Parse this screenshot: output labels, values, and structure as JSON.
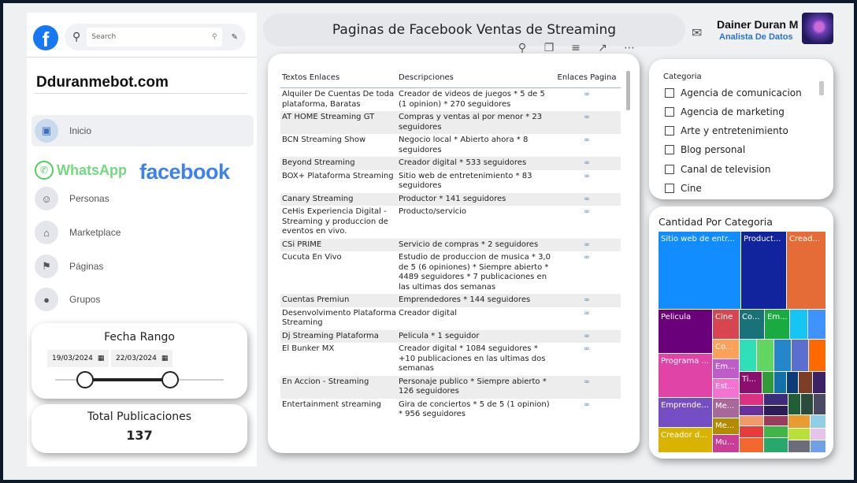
{
  "sidebar": {
    "search_placeholder": "Search",
    "site_title": "Dduranmebot.com",
    "nav": [
      {
        "label": "Inicio",
        "icon": "home-icon"
      },
      {
        "label": "Personas",
        "icon": "people-icon"
      },
      {
        "label": "Marketplace",
        "icon": "store-icon"
      },
      {
        "label": "Páginas",
        "icon": "flag-icon"
      },
      {
        "label": "Grupos",
        "icon": "groups-icon"
      }
    ],
    "whatsapp_label": "WhatsApp",
    "facebook_label": "facebook"
  },
  "date_range": {
    "title": "Fecha Rango",
    "start": "19/03/2024",
    "end": "22/03/2024"
  },
  "kpi": {
    "label": "Total Publicaciones",
    "value": "137"
  },
  "header": {
    "title": "Paginas de Facebook Ventas de Streaming",
    "user_name": "Dainer Duran M",
    "user_role": "Analista De Datos"
  },
  "table": {
    "headers": [
      "Textos Enlaces",
      "Descripciones",
      "Enlaces Pagina"
    ],
    "rows": [
      [
        "Alquiler De Cuentas De toda plataforma, Baratas",
        "Creador de videos de juegos * 5 de 5 (1 opinion) * 270 seguidores"
      ],
      [
        "AT HOME Streaming GT",
        "Compras y ventas al por menor * 23 seguidores"
      ],
      [
        "BCN Streaming Show",
        "Negocio local * Abierto ahora * 8 seguidores"
      ],
      [
        "Beyond Streaming",
        "Creador digital * 533 seguidores"
      ],
      [
        "BOX+ Plataforma Streaming",
        "Sitio web de entretenimiento * 83 seguidores"
      ],
      [
        "Canary Streaming",
        "Productor * 141 seguidores"
      ],
      [
        "CeHis Experiencia Digital - Streaming y produccion de eventos en vivo.",
        "Producto/servicio"
      ],
      [
        "CSi PRIME",
        "Servicio de compras * 2 seguidores"
      ],
      [
        "Cucuta En Vivo",
        "Estudio de produccion de musica * 3,0 de 5 (6 opiniones) * Siempre abierto * 4489 seguidores * 7 publicaciones en las ultimas dos semanas"
      ],
      [
        "Cuentas Premiun",
        "Emprendedores * 144 seguidores"
      ],
      [
        "Desenvolvimento Plataforma Streaming",
        "Creador digital"
      ],
      [
        "Dj Streaming Plataforma",
        "Pelicula * 1 seguidor"
      ],
      [
        "El Bunker MX",
        "Creador digital * 1084 seguidores * +10 publicaciones en las ultimas dos semanas"
      ],
      [
        "En Accion - Streaming",
        "Personaje publico * Siempre abierto * 126 seguidores"
      ],
      [
        "Entertainment streaming",
        "Gira de conciertos * 5 de 5 (1 opinion) * 956 seguidores"
      ]
    ]
  },
  "category": {
    "title": "Categoria",
    "items": [
      "Agencia de comunicacion",
      "Agencia de marketing",
      "Arte y entretenimiento",
      "Blog personal",
      "Canal de television",
      "Cine"
    ]
  },
  "treemap": {
    "title": "Cantidad Por Categoria",
    "labels": [
      "Sitio web de entr...",
      "Product...",
      "Cread...",
      "Pelicula",
      "Cine",
      "Co...",
      "Em...",
      "Programa ...",
      "Co...",
      "Em...",
      "Est...",
      "Ti...",
      "Emprende...",
      "Me...",
      "Me...",
      "Creador d...",
      "Mu..."
    ]
  }
}
